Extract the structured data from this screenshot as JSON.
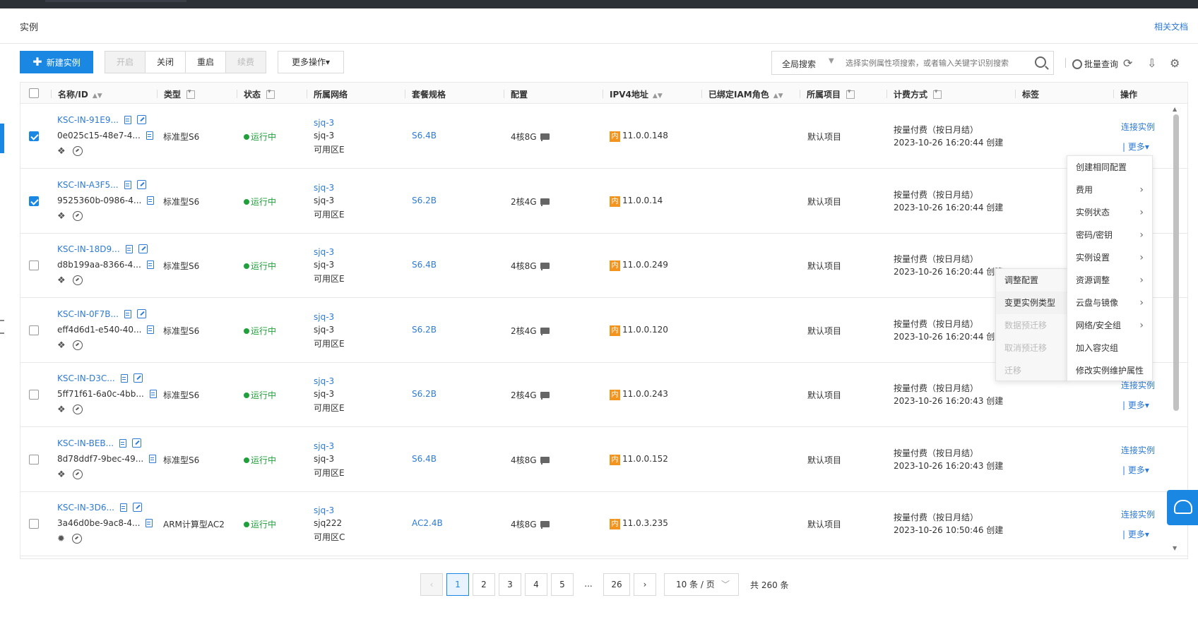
{
  "header": {
    "title": "实例",
    "doc_link": "相关文档"
  },
  "toolbar": {
    "create": "新建实例",
    "start": "开启",
    "stop": "关闭",
    "restart": "重启",
    "renew": "续费",
    "more": "更多操作",
    "search_scope": "全局搜索",
    "search_placeholder": "选择实例属性项搜索，或者输入关键字识别搜索",
    "batch_query": "批量查询"
  },
  "columns": {
    "name_id": "名称/ID",
    "type": "类型",
    "status": "状态",
    "network": "所属网络",
    "package": "套餐规格",
    "config": "配置",
    "ipv4": "IPV4地址",
    "iam": "已绑定IAM角色",
    "project": "所属项目",
    "billing": "计费方式",
    "tags": "标签",
    "actions": "操作"
  },
  "ip_badge": "内",
  "connect_label": "连接实例",
  "more_label": "| 更多",
  "rows": [
    {
      "checked": true,
      "name": "KSC-IN-91E9...",
      "id": "0e025c15-48e7-4...",
      "type": "标准型S6",
      "status": "运行中",
      "vpc": "sjq-3",
      "subnet": "sjq-3",
      "zone": "可用区E",
      "pkg": "S6.4B",
      "config": "4核8G",
      "ip": "11.0.0.148",
      "project": "默认项目",
      "billing": "按量付费（按日月结）",
      "created": "2023-10-26 16:20:44 创建",
      "os": "linux",
      "show_actions": true
    },
    {
      "checked": true,
      "name": "KSC-IN-A3F5...",
      "id": "9525360b-0986-4...",
      "type": "标准型S6",
      "status": "运行中",
      "vpc": "sjq-3",
      "subnet": "sjq-3",
      "zone": "可用区E",
      "pkg": "S6.2B",
      "config": "2核4G",
      "ip": "11.0.0.14",
      "project": "默认项目",
      "billing": "按量付费（按日月结）",
      "created": "2023-10-26 16:20:44 创建",
      "os": "linux",
      "show_actions": false
    },
    {
      "checked": false,
      "name": "KSC-IN-18D9...",
      "id": "d8b199aa-8366-4...",
      "type": "标准型S6",
      "status": "运行中",
      "vpc": "sjq-3",
      "subnet": "sjq-3",
      "zone": "可用区E",
      "pkg": "S6.4B",
      "config": "4核8G",
      "ip": "11.0.0.249",
      "project": "默认项目",
      "billing": "按量付费（按日月结）",
      "created": "2023-10-26 16:20:44 创建",
      "os": "linux",
      "show_actions": false
    },
    {
      "checked": false,
      "name": "KSC-IN-0F7B...",
      "id": "eff4d6d1-e540-40...",
      "type": "标准型S6",
      "status": "运行中",
      "vpc": "sjq-3",
      "subnet": "sjq-3",
      "zone": "可用区E",
      "pkg": "S6.2B",
      "config": "2核4G",
      "ip": "11.0.0.120",
      "project": "默认项目",
      "billing": "按量付费（按日月结）",
      "created": "2023-10-26 16:20:44 创建",
      "os": "linux",
      "show_actions": false
    },
    {
      "checked": false,
      "name": "KSC-IN-D3C...",
      "id": "5ff71f61-6a0c-4bb...",
      "type": "标准型S6",
      "status": "运行中",
      "vpc": "sjq-3",
      "subnet": "sjq-3",
      "zone": "可用区E",
      "pkg": "S6.2B",
      "config": "2核4G",
      "ip": "11.0.0.243",
      "project": "默认项目",
      "billing": "按量付费（按日月结）",
      "created": "2023-10-26 16:20:43 创建",
      "os": "linux",
      "show_actions": true
    },
    {
      "checked": false,
      "name": "KSC-IN-BEB...",
      "id": "8d78ddf7-9bec-49...",
      "type": "标准型S6",
      "status": "运行中",
      "vpc": "sjq-3",
      "subnet": "sjq-3",
      "zone": "可用区E",
      "pkg": "S6.4B",
      "config": "4核8G",
      "ip": "11.0.0.152",
      "project": "默认项目",
      "billing": "按量付费（按日月结）",
      "created": "2023-10-26 16:20:43 创建",
      "os": "linux",
      "show_actions": true
    },
    {
      "checked": false,
      "name": "KSC-IN-3D6...",
      "id": "3a46d0be-9ac8-4...",
      "type": "ARM计算型AC2",
      "status": "运行中",
      "vpc": "sjq-3",
      "subnet": "sjq222",
      "zone": "可用区C",
      "pkg": "AC2.4B",
      "config": "4核8G",
      "ip": "11.0.3.235",
      "project": "默认项目",
      "billing": "按量付费（按日月结）",
      "created": "2023-10-26 10:50:46 创建",
      "os": "gear",
      "show_actions": true
    }
  ],
  "menu": [
    {
      "label": "创建相同配置",
      "arrow": false
    },
    {
      "label": "费用",
      "arrow": true
    },
    {
      "label": "实例状态",
      "arrow": true
    },
    {
      "label": "密码/密钥",
      "arrow": true
    },
    {
      "label": "实例设置",
      "arrow": true
    },
    {
      "label": "资源调整",
      "arrow": true
    },
    {
      "label": "云盘与镜像",
      "arrow": true
    },
    {
      "label": "网络/安全组",
      "arrow": true
    },
    {
      "label": "加入容灾组",
      "arrow": false
    },
    {
      "label": "修改实例维护属性",
      "arrow": false
    }
  ],
  "submenu": [
    {
      "label": "调整配置",
      "state": "normal"
    },
    {
      "label": "变更实例类型",
      "state": "active"
    },
    {
      "label": "数据预迁移",
      "state": "disabled"
    },
    {
      "label": "取消预迁移",
      "state": "disabled"
    },
    {
      "label": "迁移",
      "state": "disabled"
    }
  ],
  "pagination": {
    "pages": [
      "1",
      "2",
      "3",
      "4",
      "5",
      "...",
      "26"
    ],
    "current": "1",
    "page_size": "10 条 / 页",
    "total": "共 260 条"
  }
}
